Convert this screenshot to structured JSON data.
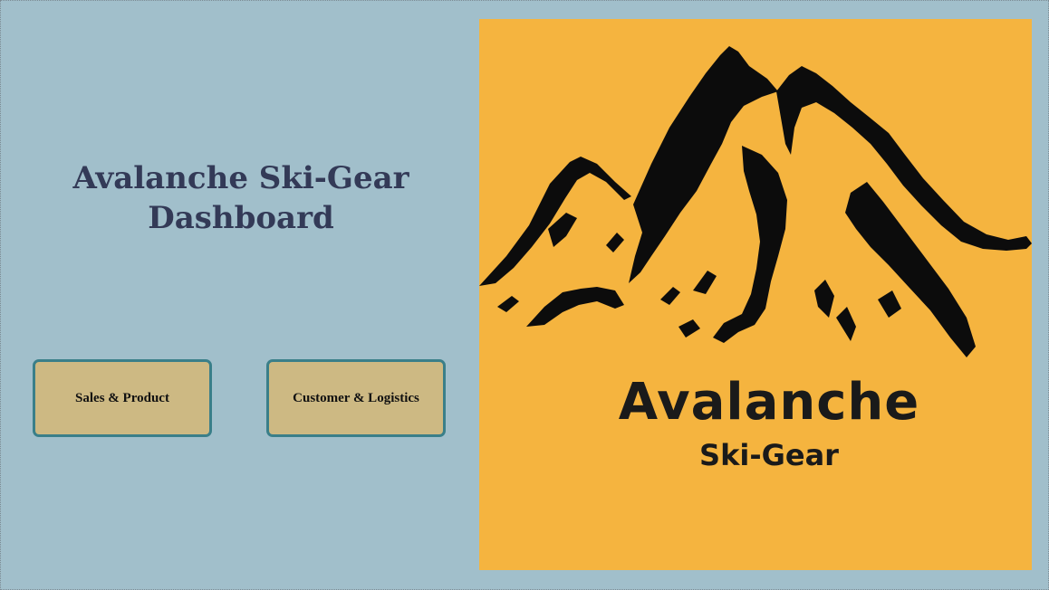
{
  "dashboard": {
    "title": "Avalanche Ski-Gear Dashboard"
  },
  "navigation": {
    "sales_product_label": "Sales & Product",
    "customer_logistics_label": "Customer & Logistics"
  },
  "logo": {
    "name": "Avalanche",
    "subtitle": "Ski-Gear",
    "icon": "mountain-icon"
  },
  "colors": {
    "background": "#a1bfcb",
    "title": "#333a57",
    "button_fill": "#cdb983",
    "button_border": "#3a7f89",
    "logo_background": "#f5b43f",
    "logo_ink": "#1a1a1a"
  }
}
